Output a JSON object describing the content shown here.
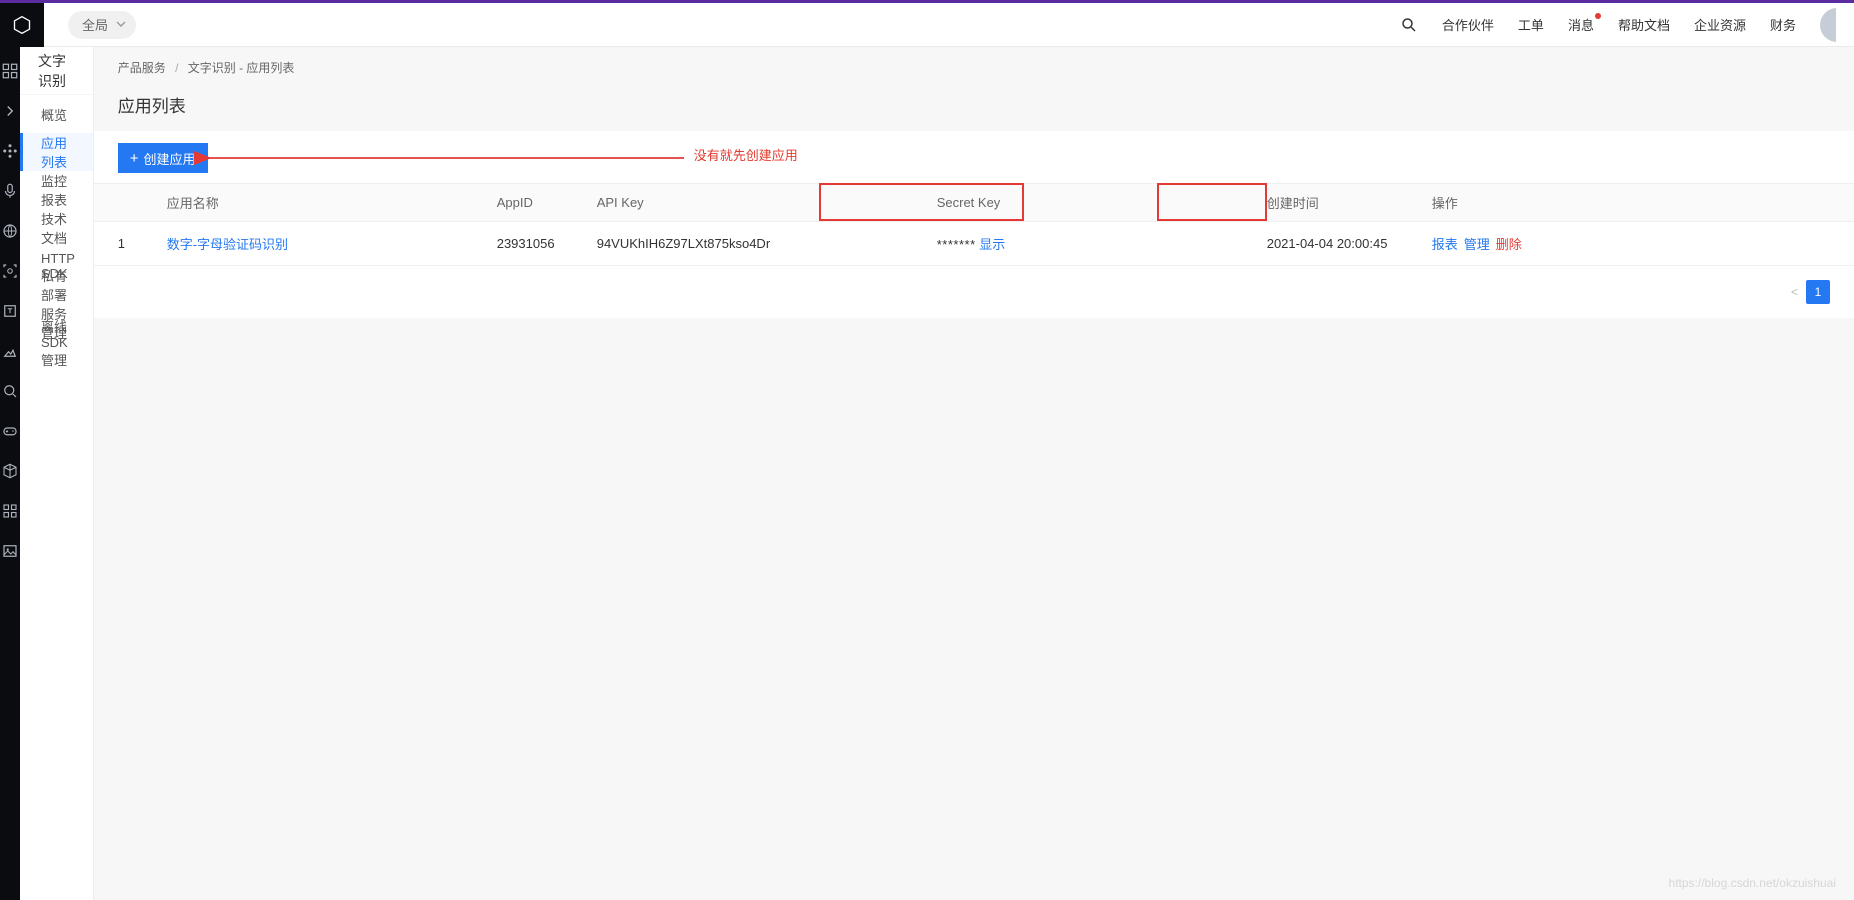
{
  "header": {
    "scope_label": "全局",
    "links": {
      "partners": "合作伙伴",
      "tickets": "工单",
      "messages": "消息",
      "help": "帮助文档",
      "resources": "企业资源",
      "finance": "财务"
    }
  },
  "subnav": {
    "title": "文字识别",
    "items": [
      {
        "label": "概览",
        "active": false
      },
      {
        "label": "应用列表",
        "active": true
      },
      {
        "label": "监控报表",
        "active": false
      },
      {
        "label": "技术文档",
        "active": false
      },
      {
        "label": "HTTP SDK",
        "active": false
      },
      {
        "label": "私有部署服务管理",
        "active": false
      },
      {
        "label": "离线SDK管理",
        "active": false
      }
    ]
  },
  "breadcrumb": {
    "c1": "产品服务",
    "c2": "文字识别 - 应用列表"
  },
  "page": {
    "title": "应用列表",
    "create_button": "创建应用",
    "note": "没有就先创建应用"
  },
  "table": {
    "columns": {
      "idx": "",
      "name": "应用名称",
      "appid": "AppID",
      "apikey": "API Key",
      "secret": "Secret Key",
      "created": "创建时间",
      "ops": "操作"
    },
    "ops_labels": {
      "report": "报表",
      "manage": "管理",
      "delete": "删除",
      "show": "显示"
    },
    "rows": [
      {
        "idx": "1",
        "name": "数字-字母验证码识别",
        "appid": "23931056",
        "apikey": "94VUKhIH6Z97LXt875kso4Dr",
        "secret_masked": "*******",
        "created": "2021-04-04 20:00:45"
      }
    ]
  },
  "pager": {
    "prev": "<",
    "page": "1"
  },
  "watermark": "https://blog.csdn.net/okzuishuai"
}
